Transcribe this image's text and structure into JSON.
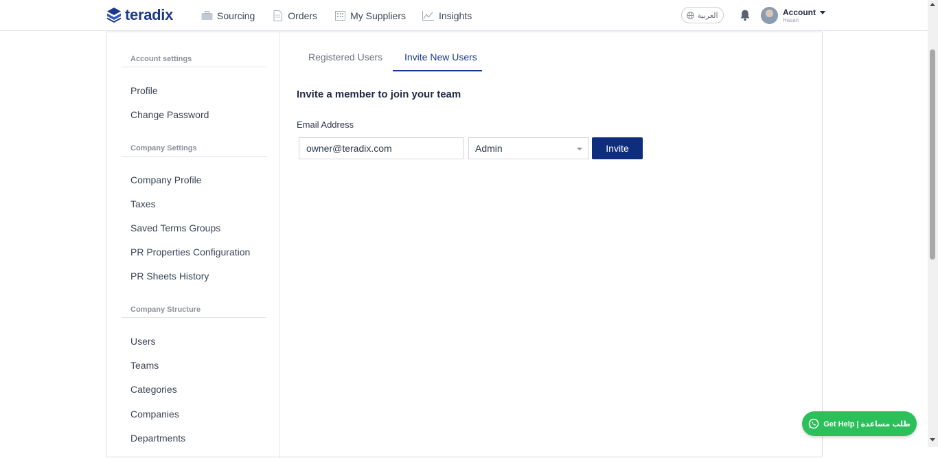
{
  "app": {
    "brand": "teradix",
    "brand_color": "#1d3a8a",
    "primary_button_color": "#0f2d7d",
    "help_color": "#2cc05a"
  },
  "nav": {
    "items": [
      {
        "label": "Sourcing",
        "icon": "briefcase-icon"
      },
      {
        "label": "Orders",
        "icon": "document-icon"
      },
      {
        "label": "My Suppliers",
        "icon": "building-icon"
      },
      {
        "label": "Insights",
        "icon": "chart-icon"
      }
    ]
  },
  "header": {
    "language": "العربية",
    "account_label": "Account",
    "account_user": "Hasan"
  },
  "sidebar": {
    "sections": [
      {
        "title": "Account settings",
        "items": [
          "Profile",
          "Change Password"
        ]
      },
      {
        "title": "Company Settings",
        "items": [
          "Company Profile",
          "Taxes",
          "Saved Terms Groups",
          "PR Properties Configuration",
          "PR Sheets History"
        ]
      },
      {
        "title": "Company Structure",
        "items": [
          "Users",
          "Teams",
          "Categories",
          "Companies",
          "Departments"
        ]
      }
    ]
  },
  "tabs": [
    {
      "label": "Registered Users",
      "active": false
    },
    {
      "label": "Invite New Users",
      "active": true
    }
  ],
  "invite": {
    "heading": "Invite a member to join your team",
    "email_label": "Email Address",
    "email_value": "owner@teradix.com",
    "role_value": "Admin",
    "invite_label": "Invite"
  },
  "help": {
    "label": "Get Help | طلب مساعدة"
  }
}
